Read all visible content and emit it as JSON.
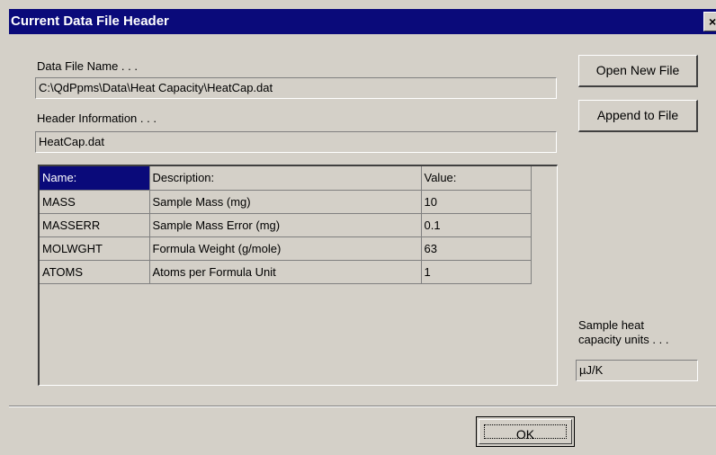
{
  "window": {
    "title": "Current Data File Header",
    "close_label": "×"
  },
  "file": {
    "name_label": "Data File Name . . .",
    "name_value": "C:\\QdPpms\\Data\\Heat Capacity\\HeatCap.dat",
    "header_label": "Header Information . . .",
    "header_value": "HeatCap.dat"
  },
  "buttons": {
    "open_new": "Open New File",
    "append": "Append to File",
    "ok": "OK"
  },
  "table": {
    "columns": [
      "Name:",
      "Description:",
      "Value:"
    ],
    "rows": [
      {
        "name": "MASS",
        "description": "Sample Mass (mg)",
        "value": "10"
      },
      {
        "name": "MASSERR",
        "description": "Sample Mass Error (mg)",
        "value": "0.1"
      },
      {
        "name": "MOLWGHT",
        "description": "Formula Weight (g/mole)",
        "value": "63"
      },
      {
        "name": "ATOMS",
        "description": "Atoms per Formula Unit",
        "value": "1"
      }
    ]
  },
  "units": {
    "label_line1": "Sample heat",
    "label_line2": "capacity units . . .",
    "value": "µJ/K"
  }
}
